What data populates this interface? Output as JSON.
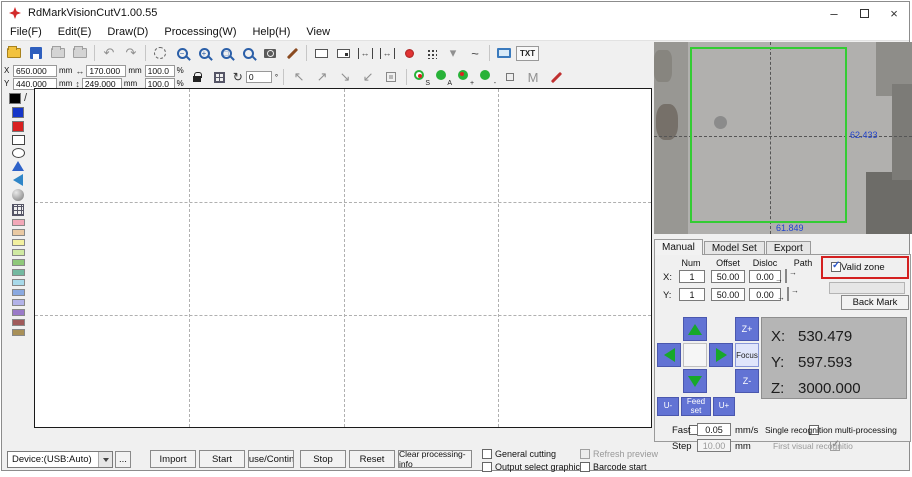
{
  "window": {
    "title": "RdMarkVisionCutV1.00.55"
  },
  "titlebar": {
    "minimize": "–",
    "close": "×"
  },
  "menu": {
    "items": [
      "File(F)",
      "Edit(E)",
      "Draw(D)",
      "Processing(W)",
      "Help(H)",
      "View"
    ]
  },
  "toolbar": {
    "txt": "TXT"
  },
  "params": {
    "x_label": "X",
    "x_value": "650.000",
    "x_unit": "mm",
    "y_label": "Y",
    "y_value": "440.000",
    "y_unit": "mm",
    "w_value": "170.000",
    "w_unit": "mm",
    "h_value": "249.000",
    "h_unit": "mm",
    "sx_value": "100.0",
    "sx_unit": "%",
    "sy_value": "100.0",
    "sy_unit": "%",
    "rot_value": "0",
    "rot_unit": "°",
    "spot_s": "S",
    "spot_a": "A",
    "spot_plus": "+",
    "spot_minus": "-",
    "m_label": "M"
  },
  "preview": {
    "dim_right": "62.433",
    "dim_bottom": "61.849"
  },
  "tabs": {
    "manual": "Manual",
    "model_set": "Model Set",
    "export": "Export",
    "active": "Manual"
  },
  "manual": {
    "col_num": "Num",
    "col_offset": "Offset",
    "col_disloc": "Disloc",
    "col_path": "Path",
    "x_label": "X:",
    "y_label": "Y:",
    "x_num": "1",
    "x_offset": "50.00",
    "x_disloc": "0.00",
    "y_num": "1",
    "y_offset": "50.00",
    "y_disloc": "0.00",
    "valid_zone": "Valid zone",
    "valid_zone_checked": true,
    "back_mark": "Back Mark",
    "back_mark_checked": true,
    "z_plus": "Z+",
    "z_minus": "Z-",
    "focus": "Focus",
    "u_minus": "U-",
    "feed_set": "Feed set",
    "u_plus": "U+",
    "coord_x_label": "X:",
    "coord_x": "530.479",
    "coord_y_label": "Y:",
    "coord_y": "597.593",
    "coord_z_label": "Z:",
    "coord_z": "3000.000",
    "fast_label": "Fast",
    "fast_value": "0.05",
    "fast_unit": "mm/s",
    "fast_checked": false,
    "step_label": "Step",
    "step_value": "10.00",
    "step_unit": "mm",
    "step_checked": false,
    "single_label": "Single recognition multi-processing",
    "single_checked": false,
    "first_label": "First visual recognitio",
    "first_checked": true
  },
  "bottom": {
    "device": "Device:(USB:Auto)",
    "browse": "...",
    "import": "Import",
    "start": "Start",
    "pause": "Pause/Continue",
    "stop": "Stop",
    "reset": "Reset",
    "clear": "Clear processing-info",
    "general_cutting": "General cutting",
    "general_checked": false,
    "output_select": "Output select graphics",
    "output_checked": false,
    "refresh_preview": "Refresh preview",
    "refresh_checked": false,
    "barcode_start": "Barcode start",
    "barcode_checked": false
  },
  "icons": {
    "undo": "↶",
    "redo": "↷",
    "nw": "↖",
    "ne": "↗",
    "se": "↘",
    "sw": "↙",
    "width": "↔",
    "height": "↕",
    "rotate": "↻",
    "dropdown": "▾",
    "wave": "~"
  },
  "sidebar": {
    "black": "#000000",
    "blue": "#1636c8",
    "red": "#d82020",
    "palette": [
      "#f2a8b8",
      "#e9c9a3",
      "#f2f0a0",
      "#cfe9a2",
      "#8fc87a",
      "#74b9a0",
      "#a8d9e9",
      "#8aa9e0",
      "#b2b2e8",
      "#9a7ac8",
      "#a05a5a",
      "#a89058"
    ]
  },
  "colors": {
    "annotation_red": "#d42020",
    "jog_blue": "#6273d4",
    "arrow_green": "#17a82a",
    "preview_green": "#33cc33",
    "dim_blue": "#2244cc"
  }
}
